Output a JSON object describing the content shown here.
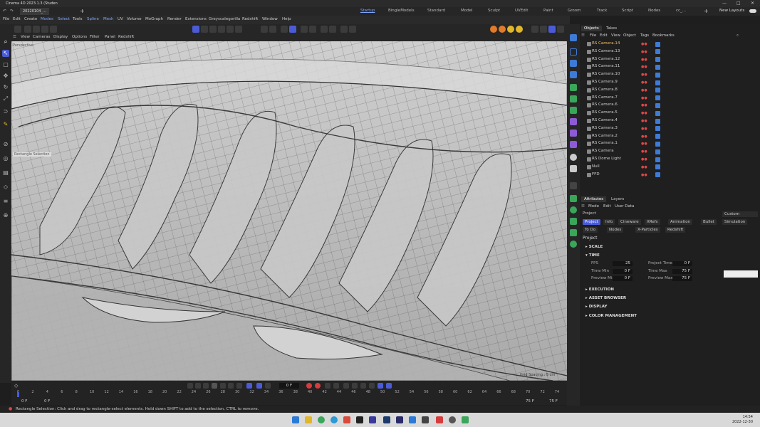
{
  "window": {
    "title": "Cinema 4D 2023.1.3 (Studen",
    "file_tab": "20220104_...",
    "controls": [
      "—",
      "□",
      "✕"
    ]
  },
  "layouts": {
    "tabs": [
      "Startup",
      "BingleModels",
      "Standard",
      "Model",
      "Sculpt",
      "UVEdit",
      "Paint",
      "Groom",
      "Track",
      "Script",
      "Nodes",
      "cc_..."
    ],
    "active": "Startup",
    "new_layouts": "New Layouts"
  },
  "menu": [
    "File",
    "Edit",
    "Create",
    "Modes",
    "Select",
    "Tools",
    "Spline",
    "Mesh",
    "UV",
    "Volume",
    "MoGraph",
    "Render",
    "Extensions",
    "Greyscalegorilla",
    "Redshift",
    "Window",
    "Help"
  ],
  "viewport_menu": [
    "View",
    "Cameras",
    "Display",
    "Options",
    "Filter",
    "Panel",
    "Redshift"
  ],
  "viewport": {
    "camera_label": "Perspective",
    "tool_label": "Rectangle Selection",
    "grid_spacing": "Grid Spacing : 5 cm"
  },
  "timeline": {
    "current_frame": "0 F",
    "start": "0 F",
    "start2": "0 F",
    "end": "75 F",
    "end2": "75 F",
    "ticks": [
      "0",
      "2",
      "4",
      "6",
      "8",
      "10",
      "12",
      "14",
      "16",
      "18",
      "20",
      "22",
      "24",
      "26",
      "28",
      "30",
      "32",
      "34",
      "36",
      "38",
      "40",
      "42",
      "44",
      "46",
      "48",
      "50",
      "52",
      "54",
      "56",
      "58",
      "60",
      "62",
      "64",
      "66",
      "68",
      "70",
      "72",
      "74"
    ]
  },
  "status": "Rectangle Selection: Click and drag to rectangle-select elements. Hold down SHIFT to add to the selection, CTRL to remove.",
  "objects_panel": {
    "tabs": [
      "Objects",
      "Takes"
    ],
    "menu": [
      "File",
      "Edit",
      "View",
      "Object",
      "Tags",
      "Bookmarks"
    ],
    "items": [
      {
        "name": "RS Camera.14",
        "selected": true
      },
      {
        "name": "RS Camera.13"
      },
      {
        "name": "RS Camera.12"
      },
      {
        "name": "RS Camera.11"
      },
      {
        "name": "RS Camera.10"
      },
      {
        "name": "RS Camera.9"
      },
      {
        "name": "RS Camera.8"
      },
      {
        "name": "RS Camera.7"
      },
      {
        "name": "RS Camera.6"
      },
      {
        "name": "RS Camera.5"
      },
      {
        "name": "RS Camera.4"
      },
      {
        "name": "RS Camera.3"
      },
      {
        "name": "RS Camera.2"
      },
      {
        "name": "RS Camera.1"
      },
      {
        "name": "RS Camera"
      },
      {
        "name": "RS Dome Light"
      },
      {
        "name": "Null"
      },
      {
        "name": "FFD"
      }
    ]
  },
  "attributes_panel": {
    "tabs": [
      "Attributes",
      "Layers"
    ],
    "menu": [
      "Mode",
      "Edit",
      "User Data"
    ],
    "object_label": "Project",
    "preset": "Custom",
    "buttons_row1": [
      "Project",
      "Info",
      "Cineware",
      "XRefs",
      "Animation",
      "Bullet",
      "Simulation"
    ],
    "buttons_row2": [
      "To Do",
      "Nodes",
      "X-Particles",
      "Redshift"
    ],
    "heading": "Project",
    "sections": [
      "SCALE",
      "TIME",
      "EXECUTION",
      "ASSET BROWSER",
      "DISPLAY",
      "COLOR MANAGEMENT"
    ],
    "time": {
      "fps_label": "FPS",
      "fps": "25",
      "project_time_label": "Project Time",
      "project_time": "0 F",
      "time_min_label": "Time Min",
      "time_min": "0 F",
      "time_max_label": "Time Max",
      "time_max": "75 F",
      "preview_min_label": "Preview Min",
      "preview_min": "0 F",
      "preview_max_label": "Preview Max",
      "preview_max": "75 F"
    }
  },
  "taskbar": {
    "time": "14:54",
    "date": "2022-12-30"
  },
  "colors": {
    "accent": "#4b5bd6",
    "selection": "#f0c36a"
  }
}
